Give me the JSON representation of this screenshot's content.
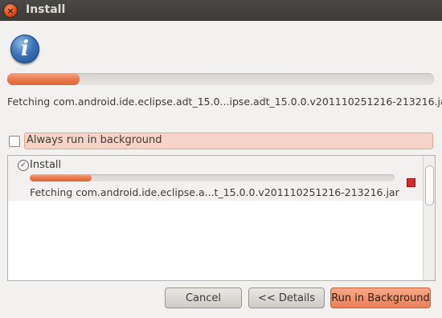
{
  "window": {
    "title": "Install"
  },
  "dialog": {
    "main_progress": 0.17,
    "status": "Fetching com.android.ide.eclipse.adt_15.0...ipse.adt_15.0.0.v201110251216-213216.jar",
    "always_background_label": "Always run in background",
    "always_background_checked": false
  },
  "job": {
    "title": "Install",
    "progress": 0.17,
    "status": "Fetching com.android.ide.eclipse.a...t_15.0.0.v201110251216-213216.jar"
  },
  "buttons": {
    "cancel": "Cancel",
    "details": "<< Details",
    "background": "Run in Background"
  },
  "colors": {
    "accent": "#e9764a",
    "titlebar": "#3c3b37",
    "highlight": "#f5d3c6"
  }
}
